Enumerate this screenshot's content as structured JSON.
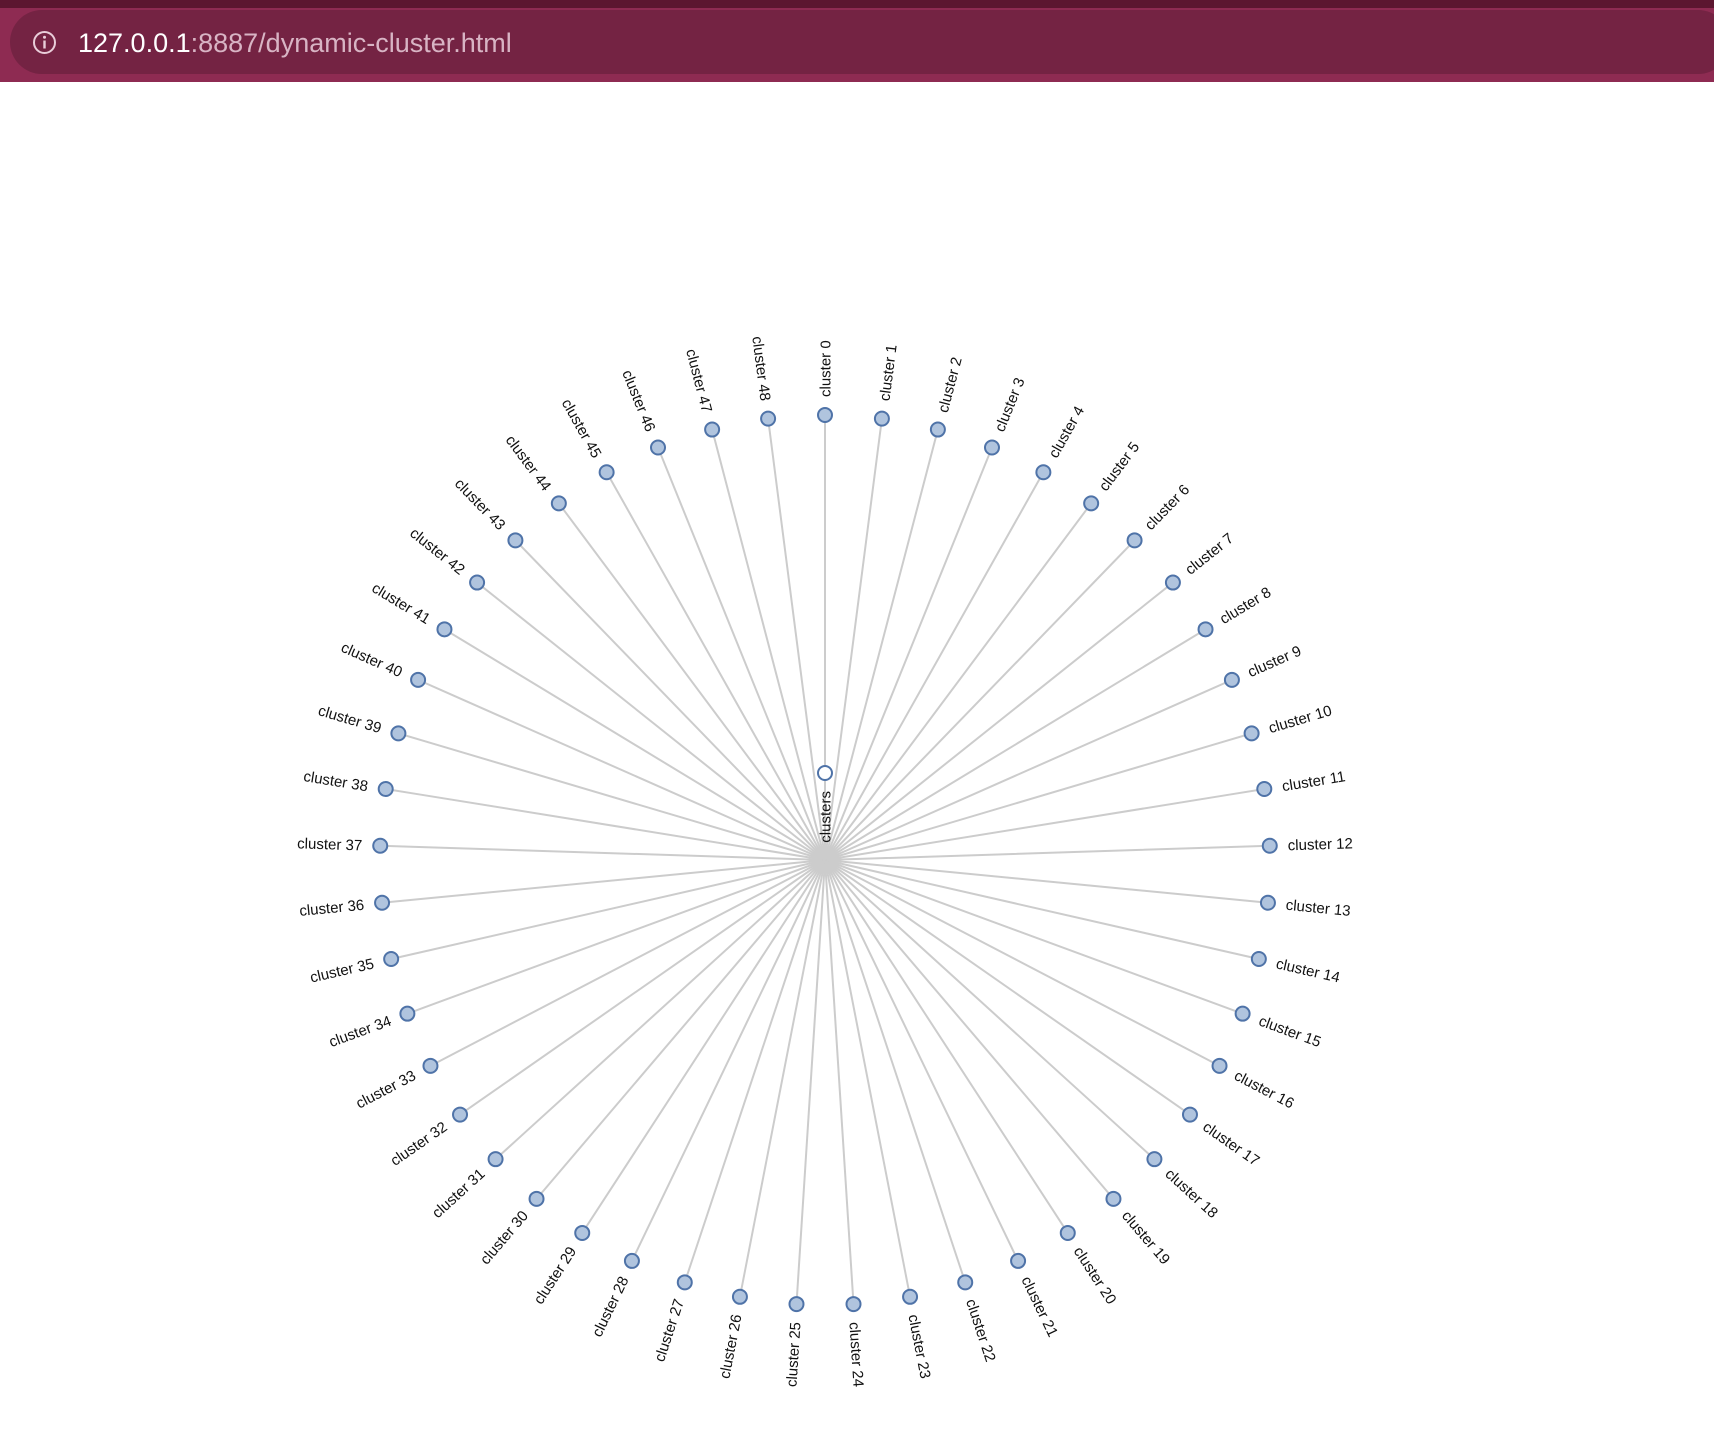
{
  "browser": {
    "url_host": "127.0.0.1",
    "url_path": ":8887/dynamic-cluster.html",
    "info_icon": "info-circle-icon"
  },
  "tree": {
    "root": "clusters",
    "leaves": [
      "cluster 0",
      "cluster 1",
      "cluster 2",
      "cluster 3",
      "cluster 4",
      "cluster 5",
      "cluster 6",
      "cluster 7",
      "cluster 8",
      "cluster 9",
      "cluster 10",
      "cluster 11",
      "cluster 12",
      "cluster 13",
      "cluster 14",
      "cluster 15",
      "cluster 16",
      "cluster 17",
      "cluster 18",
      "cluster 19",
      "cluster 20",
      "cluster 21",
      "cluster 22",
      "cluster 23",
      "cluster 24",
      "cluster 25",
      "cluster 26",
      "cluster 27",
      "cluster 28",
      "cluster 29",
      "cluster 30",
      "cluster 31",
      "cluster 32",
      "cluster 33",
      "cluster 34",
      "cluster 35",
      "cluster 36",
      "cluster 37",
      "cluster 38",
      "cluster 39",
      "cluster 40",
      "cluster 41",
      "cluster 42",
      "cluster 43",
      "cluster 44",
      "cluster 45",
      "cluster 46",
      "cluster 47",
      "cluster 48"
    ],
    "colors": {
      "link": "#cccccc",
      "node_fill": "#b0c4de",
      "node_stroke": "#4f73a8",
      "root_fill": "#ffffff"
    }
  }
}
